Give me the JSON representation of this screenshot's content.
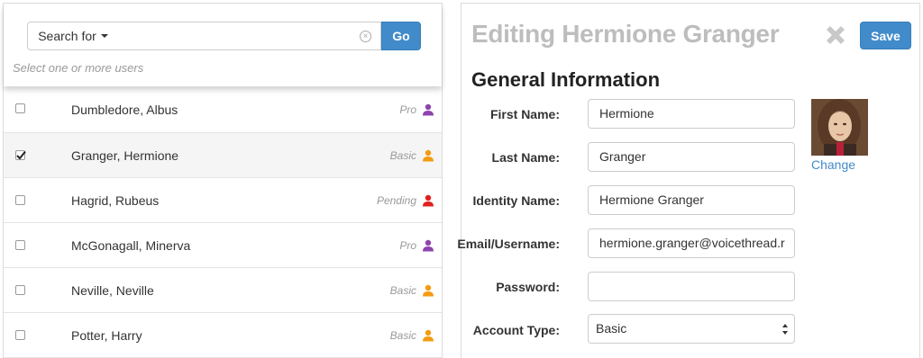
{
  "search": {
    "dropdown_label": "Search for",
    "input_value": "",
    "go_label": "Go",
    "hint": "Select one or more users"
  },
  "users": [
    {
      "name": "Dumbledore, Albus",
      "type": "Pro",
      "checked": false,
      "icon_color": "#8e44ad"
    },
    {
      "name": "Granger, Hermione",
      "type": "Basic",
      "checked": true,
      "icon_color": "#f39c12"
    },
    {
      "name": "Hagrid, Rubeus",
      "type": "Pending",
      "checked": false,
      "icon_color": "#e02020"
    },
    {
      "name": "McGonagall, Minerva",
      "type": "Pro",
      "checked": false,
      "icon_color": "#8e44ad"
    },
    {
      "name": "Neville, Neville",
      "type": "Basic",
      "checked": false,
      "icon_color": "#f39c12"
    },
    {
      "name": "Potter, Harry",
      "type": "Basic",
      "checked": false,
      "icon_color": "#f39c12"
    }
  ],
  "editor": {
    "title": "Editing Hermione Granger",
    "save_label": "Save",
    "section_title": "General Information",
    "change_label": "Change",
    "fields": {
      "first_name": {
        "label": "First Name:",
        "value": "Hermione"
      },
      "last_name": {
        "label": "Last Name:",
        "value": "Granger"
      },
      "identity_name": {
        "label": "Identity Name:",
        "value": "Hermione Granger"
      },
      "email": {
        "label": "Email/Username:",
        "value": "hermione.granger@voicethread.r"
      },
      "password": {
        "label": "Password:",
        "value": ""
      },
      "account_type": {
        "label": "Account Type:",
        "value": "Basic"
      }
    }
  },
  "colors": {
    "accent": "#428bca",
    "pro": "#8e44ad",
    "basic": "#f39c12",
    "pending": "#e02020"
  }
}
